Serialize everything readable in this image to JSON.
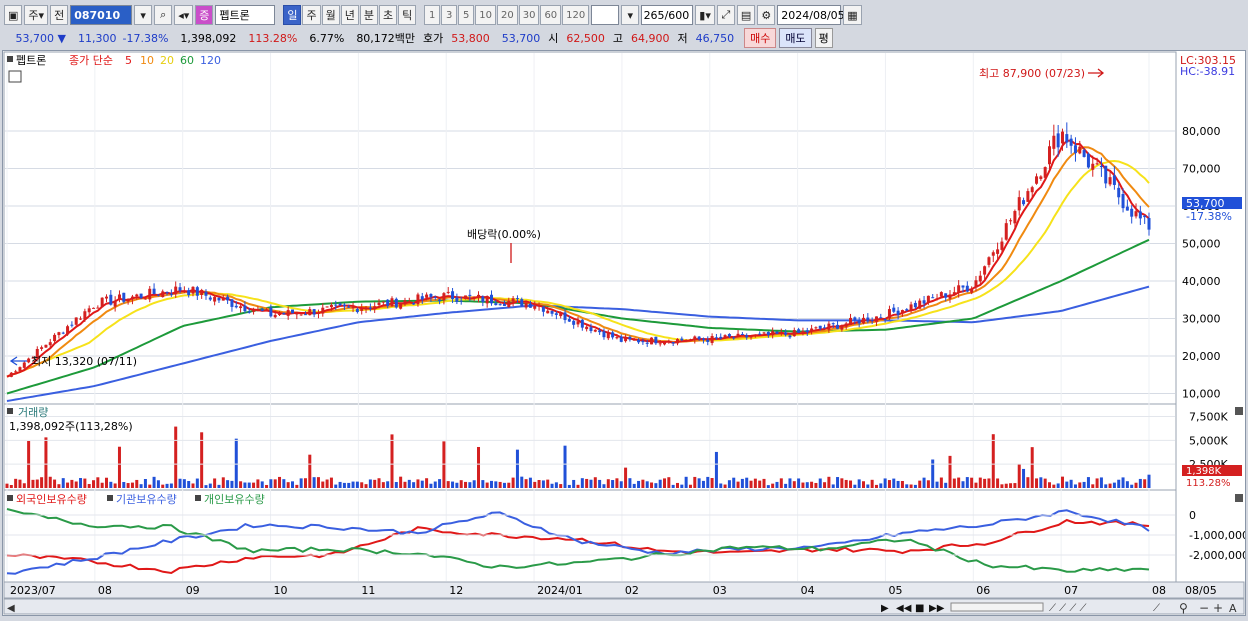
{
  "toolbar": {
    "market": "주",
    "prev_btn": "전",
    "stock_code": "087010",
    "stock_tag": "증",
    "stock_name": "펩트론",
    "periods": [
      "일",
      "주",
      "월",
      "년",
      "분",
      "초",
      "틱"
    ],
    "active_period": "일",
    "intervals": [
      "1",
      "3",
      "5",
      "10",
      "20",
      "30",
      "60",
      "120"
    ],
    "bar_count": "265",
    "bar_max": "/600",
    "date": "2024/08/05"
  },
  "quote": {
    "price": "53,700",
    "change": "11,300",
    "change_pct": "-17.38%",
    "volume": "1,398,092",
    "volume_ratio": "113.28%",
    "turnover": "6.77%",
    "amount": "80,172백만",
    "ask_label": "호가",
    "ask": "53,800",
    "bid": "53,700",
    "open_label": "시",
    "open": "62,500",
    "high_label": "고",
    "high": "64,900",
    "low_label": "저",
    "low": "46,750",
    "buy_btn": "매수",
    "sell_btn": "매도",
    "avg_btn": "평"
  },
  "price_panel": {
    "legend_name": "펩트론",
    "legend_ma_label": "종가 단순",
    "ma_periods": [
      "5",
      "10",
      "20",
      "60",
      "120"
    ],
    "lc": "LC:303.15",
    "hc": "HC:-38.91",
    "high_note": "최고 87,900 (07/23)",
    "low_note": "최저 13,320 (07/11)",
    "dividend_note": "배당락(0.00%)",
    "current_price": "53,700",
    "current_pct": "-17.38%"
  },
  "volume_panel": {
    "title": "거래량",
    "info": "1,398,092주(113,28%)",
    "current": "1,398K",
    "current_pct": "113.28%"
  },
  "holdings_panel": {
    "legend": [
      "외국인보유수량",
      "기관보유수량",
      "개인보유수량"
    ]
  },
  "x_axis": {
    "labels": [
      "2023/07",
      "08",
      "09",
      "10",
      "11",
      "12",
      "2024/01",
      "02",
      "03",
      "04",
      "05",
      "06",
      "07",
      "08",
      "08/05"
    ]
  },
  "colors": {
    "ma5": "#e01818",
    "ma10": "#f08a10",
    "ma20": "#f6e21a",
    "ma60": "#1d9a3a",
    "ma120": "#3a5fe0",
    "up": "#d42020",
    "down": "#2050d8",
    "foreign": "#e01818",
    "institution": "#3a5fe0",
    "individual": "#2a9a48"
  },
  "chart_data": [
    {
      "type": "candlestick",
      "title": "펩트론",
      "ylim": [
        8000,
        96000
      ],
      "y_ticks": [
        "10,000",
        "20,000",
        "30,000",
        "40,000",
        "50,000",
        "60,000",
        "70,000",
        "80,000"
      ],
      "x_months": [
        "2023/07",
        "08",
        "09",
        "10",
        "11",
        "12",
        "2024/01",
        "02",
        "03",
        "04",
        "05",
        "06",
        "07",
        "08"
      ],
      "close_monthly": [
        14500,
        34000,
        38000,
        31000,
        33000,
        36000,
        34000,
        24000,
        24500,
        26000,
        31000,
        39000,
        80000,
        53700
      ],
      "ma60_monthly": [
        10000,
        17000,
        28000,
        33000,
        34500,
        34800,
        34000,
        30000,
        27500,
        26500,
        27000,
        30000,
        40000,
        51000
      ],
      "ma120_monthly": [
        8000,
        12000,
        18000,
        24000,
        29000,
        31500,
        33500,
        32500,
        30500,
        29500,
        29500,
        29000,
        32000,
        38500
      ],
      "max_point": {
        "value": 87900,
        "date": "07/23"
      },
      "min_point": {
        "value": 13320,
        "date": "07/11"
      }
    },
    {
      "type": "bar",
      "title": "거래량",
      "ylim": [
        0,
        8500
      ],
      "y_ticks": [
        "2,500K",
        "5,000K",
        "7,500K"
      ],
      "last_value_k": 1398
    },
    {
      "type": "line",
      "title": "보유수량",
      "y_ticks": [
        "0",
        "-1,000,000",
        "-2,000,000"
      ],
      "series": [
        {
          "name": "외국인보유수량",
          "values": [
            -2000000,
            -2300000,
            -2800000,
            -2100000,
            -2000000,
            -700000,
            -1000000,
            -1200000,
            -1800000,
            -1900000,
            -1700000,
            -1800000,
            -1400000,
            -300000,
            -500000
          ]
        },
        {
          "name": "기관보유수량",
          "values": [
            -2900000,
            -2200000,
            -1300000,
            -500000,
            -600000,
            -900000,
            100000,
            -1300000,
            -1900000,
            -1700000,
            -1600000,
            -900000,
            -500000,
            200000,
            -700000
          ]
        },
        {
          "name": "개인보유수량",
          "values": [
            200000,
            -500000,
            -600000,
            -1800000,
            -1700000,
            -1900000,
            -2600000,
            -2400000,
            -2000000,
            -1600000,
            -1700000,
            -1200000,
            -2500000,
            -2800000,
            -2700000
          ]
        }
      ]
    }
  ]
}
